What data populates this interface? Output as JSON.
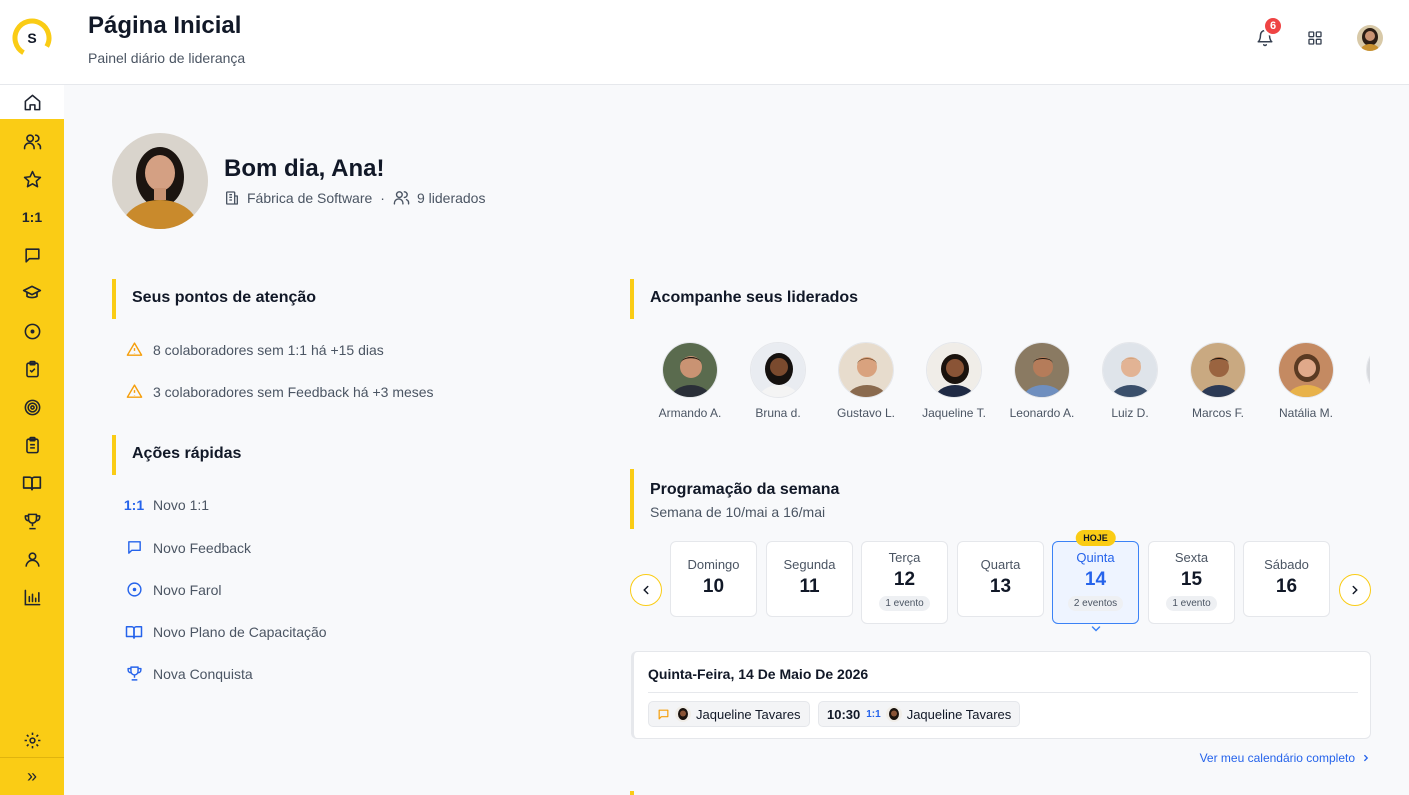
{
  "header": {
    "logo_letter": "S",
    "title": "Página Inicial",
    "subtitle": "Painel diário de liderança",
    "notifications_count": "6"
  },
  "sidebar": {
    "items": [
      {
        "icon": "home-icon"
      },
      {
        "icon": "users-icon"
      },
      {
        "icon": "star-icon"
      },
      {
        "icon": "one-on-one-icon",
        "label": "1:1"
      },
      {
        "icon": "chat-icon"
      },
      {
        "icon": "graduation-cap-icon"
      },
      {
        "icon": "target-dot-icon"
      },
      {
        "icon": "clipboard-check-icon"
      },
      {
        "icon": "bullseye-icon"
      },
      {
        "icon": "clipboard-list-icon"
      },
      {
        "icon": "book-open-icon"
      },
      {
        "icon": "trophy-icon"
      },
      {
        "icon": "user-icon"
      },
      {
        "icon": "bar-chart-icon"
      },
      {
        "icon": "settings-icon"
      },
      {
        "icon": "expand-icon",
        "label": "»"
      }
    ]
  },
  "profile": {
    "greeting": "Bom dia, Ana!",
    "department": "Fábrica de Software",
    "separator": "·",
    "team": "9 liderados"
  },
  "attention": {
    "title": "Seus pontos de atenção",
    "items": [
      "8 colaboradores sem 1:1 há +15 dias",
      "3 colaboradores sem Feedback há +3 meses"
    ]
  },
  "quick_actions": {
    "title": "Ações rápidas",
    "items": [
      {
        "icon": "one-on-one-icon",
        "glyph": "1:1",
        "label": "Novo 1:1"
      },
      {
        "icon": "chat-icon",
        "label": "Novo Feedback"
      },
      {
        "icon": "target-dot-icon",
        "label": "Novo Farol"
      },
      {
        "icon": "book-open-icon",
        "label": "Novo Plano de Capacitação"
      },
      {
        "icon": "trophy-icon",
        "label": "Nova Conquista"
      }
    ]
  },
  "team_follow": {
    "title": "Acompanhe seus liderados",
    "members": [
      "Armando A.",
      "Bruna d.",
      "Gustavo L.",
      "Jaqueline T.",
      "Leonardo A.",
      "Luiz D.",
      "Marcos F.",
      "Natália M."
    ]
  },
  "week": {
    "title": "Programação da semana",
    "subtitle": "Semana de 10/mai a 16/mai",
    "today_tag": "HOJE",
    "days": [
      {
        "name": "Domingo",
        "num": "10",
        "events": ""
      },
      {
        "name": "Segunda",
        "num": "11",
        "events": ""
      },
      {
        "name": "Terça",
        "num": "12",
        "events": "1 evento"
      },
      {
        "name": "Quarta",
        "num": "13",
        "events": ""
      },
      {
        "name": "Quinta",
        "num": "14",
        "events": "2 eventos",
        "today": true
      },
      {
        "name": "Sexta",
        "num": "15",
        "events": "1 evento"
      },
      {
        "name": "Sábado",
        "num": "16",
        "events": ""
      }
    ]
  },
  "day_detail": {
    "title": "Quinta-Feira, 14 De Maio De 2026",
    "events": [
      {
        "type": "feedback",
        "time": "",
        "person": "Jaqueline Tavares"
      },
      {
        "type": "1:1",
        "time": "10:30",
        "badge": "1:1",
        "person": "Jaqueline Tavares"
      }
    ]
  },
  "calendar_link": "Ver meu calendário completo",
  "colors": {
    "accent": "#facc15",
    "link": "#2563eb",
    "warning": "#f59e0b",
    "badge": "#ef4444"
  }
}
